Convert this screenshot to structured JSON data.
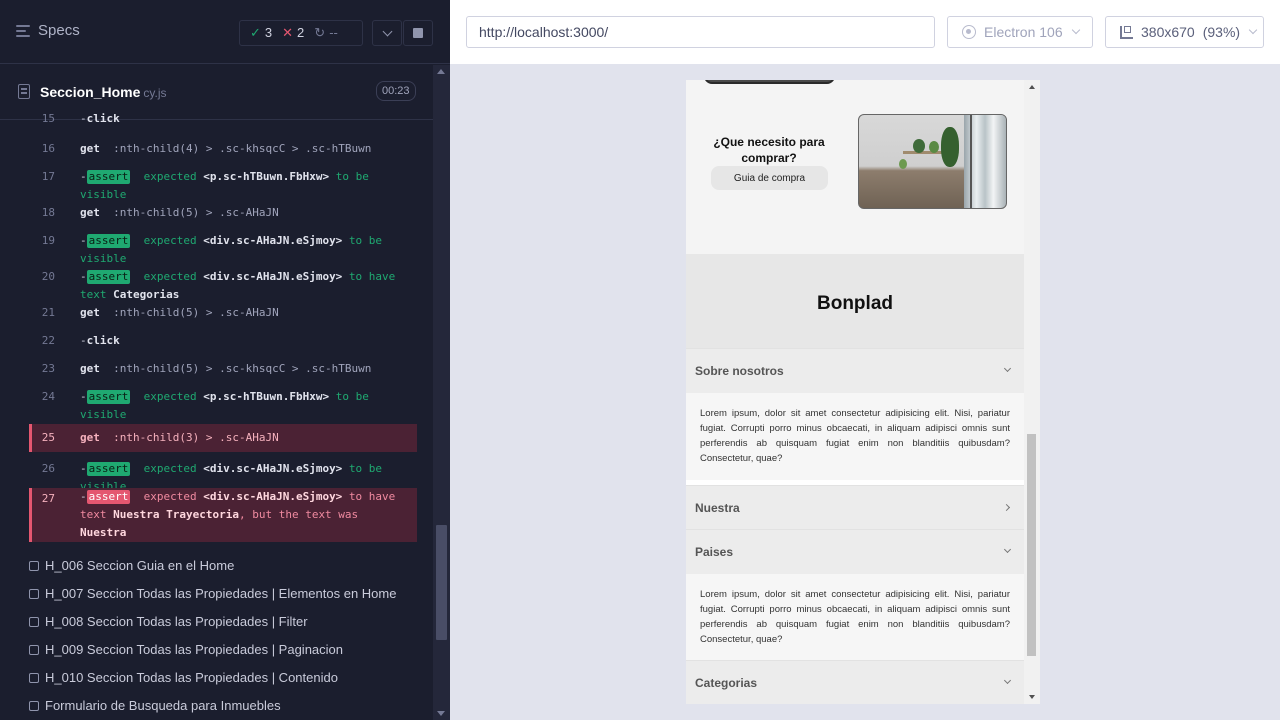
{
  "reporter": {
    "specs_label": "Specs",
    "stats": {
      "passed": "3",
      "passed_icon": "✓",
      "failed": "2",
      "failed_icon": "✕",
      "pending": "--",
      "pending_icon": "↻"
    },
    "spec": {
      "name": "Seccion_Home",
      "ext": "cy.js",
      "duration": "00:23"
    },
    "commands": [
      {
        "num": "15",
        "dash": "-",
        "kw": "click",
        "sel": ""
      },
      {
        "num": "16",
        "kw": "get",
        "sel": ":nth-child(4) > .sc-khsqcC > .sc-hTBuwn"
      },
      {
        "num": "17",
        "assert": "assert",
        "expected_text": "expected",
        "element": "<p.sc-hTBuwn.FbHxw>",
        "rest": "to be visible"
      },
      {
        "num": "18",
        "kw": "get",
        "sel": ":nth-child(5) > .sc-AHaJN"
      },
      {
        "num": "19",
        "assert": "assert",
        "expected_text": "expected",
        "element": "<div.sc-AHaJN.eSjmoy>",
        "rest": "to be visible"
      },
      {
        "num": "20",
        "assert": "assert",
        "expected_text": "expected",
        "element": "<div.sc-AHaJN.eSjmoy>",
        "rest": "to have text",
        "value": "Categorias"
      },
      {
        "num": "21",
        "kw": "get",
        "sel": ":nth-child(5) > .sc-AHaJN"
      },
      {
        "num": "22",
        "dash": "-",
        "kw": "click",
        "sel": ""
      },
      {
        "num": "23",
        "kw": "get",
        "sel": ":nth-child(5) > .sc-khsqcC > .sc-hTBuwn"
      },
      {
        "num": "24",
        "assert": "assert",
        "expected_text": "expected",
        "element": "<p.sc-hTBuwn.FbHxw>",
        "rest": "to be visible"
      },
      {
        "num": "25",
        "kw": "get",
        "sel": ":nth-child(3) > .sc-AHaJN"
      },
      {
        "num": "26",
        "assert": "assert",
        "expected_text": "expected",
        "element": "<div.sc-AHaJN.eSjmoy>",
        "rest": "to be visible"
      },
      {
        "num": "27",
        "assert": "assert",
        "expected_text": "expected",
        "element": "<div.sc-AHaJN.eSjmoy>",
        "rest": "to have text",
        "value": "Nuestra Trayectoria",
        "but": ", but the text was",
        "actual": "Nuestra"
      }
    ],
    "tests": [
      "H_006 Seccion Guia en el Home",
      "H_007 Seccion Todas las Propiedades | Elementos en Home",
      "H_008 Seccion Todas las Propiedades | Filter",
      "H_009 Seccion Todas las Propiedades | Paginacion",
      "H_010 Seccion Todas las Propiedades | Contenido",
      "Formulario de Busqueda para Inmuebles"
    ]
  },
  "aut_header": {
    "url": "http://localhost:3000/",
    "browser": "Electron 106",
    "viewport": "380x670",
    "zoom": "(93%)"
  },
  "app": {
    "guide": {
      "title": "¿Que necesito para comprar?",
      "button": "Guia de compra"
    },
    "brand": "Bonplad",
    "accordions": [
      {
        "title": "Sobre nosotros",
        "open": true,
        "text": "Lorem ipsum, dolor sit amet consectetur adipisicing elit. Nisi, pariatur fugiat. Corrupti porro minus obcaecati, in aliquam adipisci omnis sunt perferendis ab quisquam fugiat enim non blanditiis quibusdam? Consectetur, quae?"
      },
      {
        "title": "Nuestra",
        "open": false,
        "text": ""
      },
      {
        "title": "Paises",
        "open": true,
        "text": "Lorem ipsum, dolor sit amet consectetur adipisicing elit. Nisi, pariatur fugiat. Corrupti porro minus obcaecati, in aliquam adipisci omnis sunt perferendis ab quisquam fugiat enim non blanditiis quibusdam? Consectetur, quae?"
      },
      {
        "title": "Categorias",
        "open": false,
        "text": ""
      }
    ]
  },
  "colors": {
    "pass": "#1fa971",
    "fail": "#e45770",
    "bg": "#1b1e2e"
  },
  "icons": [
    "menu-icon",
    "check-icon",
    "x-icon",
    "spinner-icon",
    "chevron-down-icon",
    "stop-icon",
    "document-icon",
    "checkbox-icon",
    "electron-icon",
    "ruler-icon",
    "chevron-right-icon"
  ]
}
